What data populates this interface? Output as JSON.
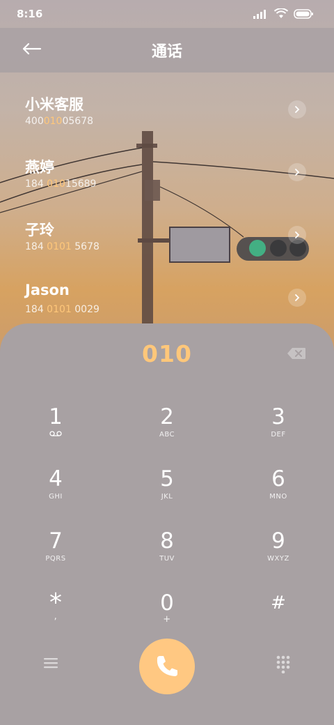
{
  "status": {
    "time": "8:16"
  },
  "header": {
    "title": "通话"
  },
  "contacts": [
    {
      "name": "小米客服",
      "num_pre": "400",
      "num_hl": "010",
      "num_post": "05678"
    },
    {
      "name": "燕婷",
      "num_pre": "184 ",
      "num_hl": "010",
      "num_post": "15689"
    },
    {
      "name": "子玲",
      "num_pre": "184 ",
      "num_hl": "0101",
      "num_post": " 5678"
    },
    {
      "name": "Jason",
      "num_pre": "184 ",
      "num_hl": "0101",
      "num_post": " 0029"
    }
  ],
  "dialpad": {
    "typed": "010",
    "keys": [
      {
        "main": "1",
        "sub": "⌕"
      },
      {
        "main": "2",
        "sub": "ABC"
      },
      {
        "main": "3",
        "sub": "DEF"
      },
      {
        "main": "4",
        "sub": "GHI"
      },
      {
        "main": "5",
        "sub": "JKL"
      },
      {
        "main": "6",
        "sub": "MNO"
      },
      {
        "main": "7",
        "sub": "PQRS"
      },
      {
        "main": "8",
        "sub": "TUV"
      },
      {
        "main": "9",
        "sub": "WXYZ"
      },
      {
        "main": "*",
        "sub": ","
      },
      {
        "main": "0",
        "sub": "+"
      },
      {
        "main": "#",
        "sub": ""
      }
    ]
  },
  "colors": {
    "accent": "#ffc77a",
    "sheet": "#a8a1a3"
  },
  "icons": [
    "back-arrow-icon",
    "signal-icon",
    "wifi-icon",
    "battery-icon",
    "chevron-right-icon",
    "backspace-icon",
    "menu-icon",
    "phone-icon",
    "dialpad-grid-icon",
    "voicemail-icon"
  ]
}
